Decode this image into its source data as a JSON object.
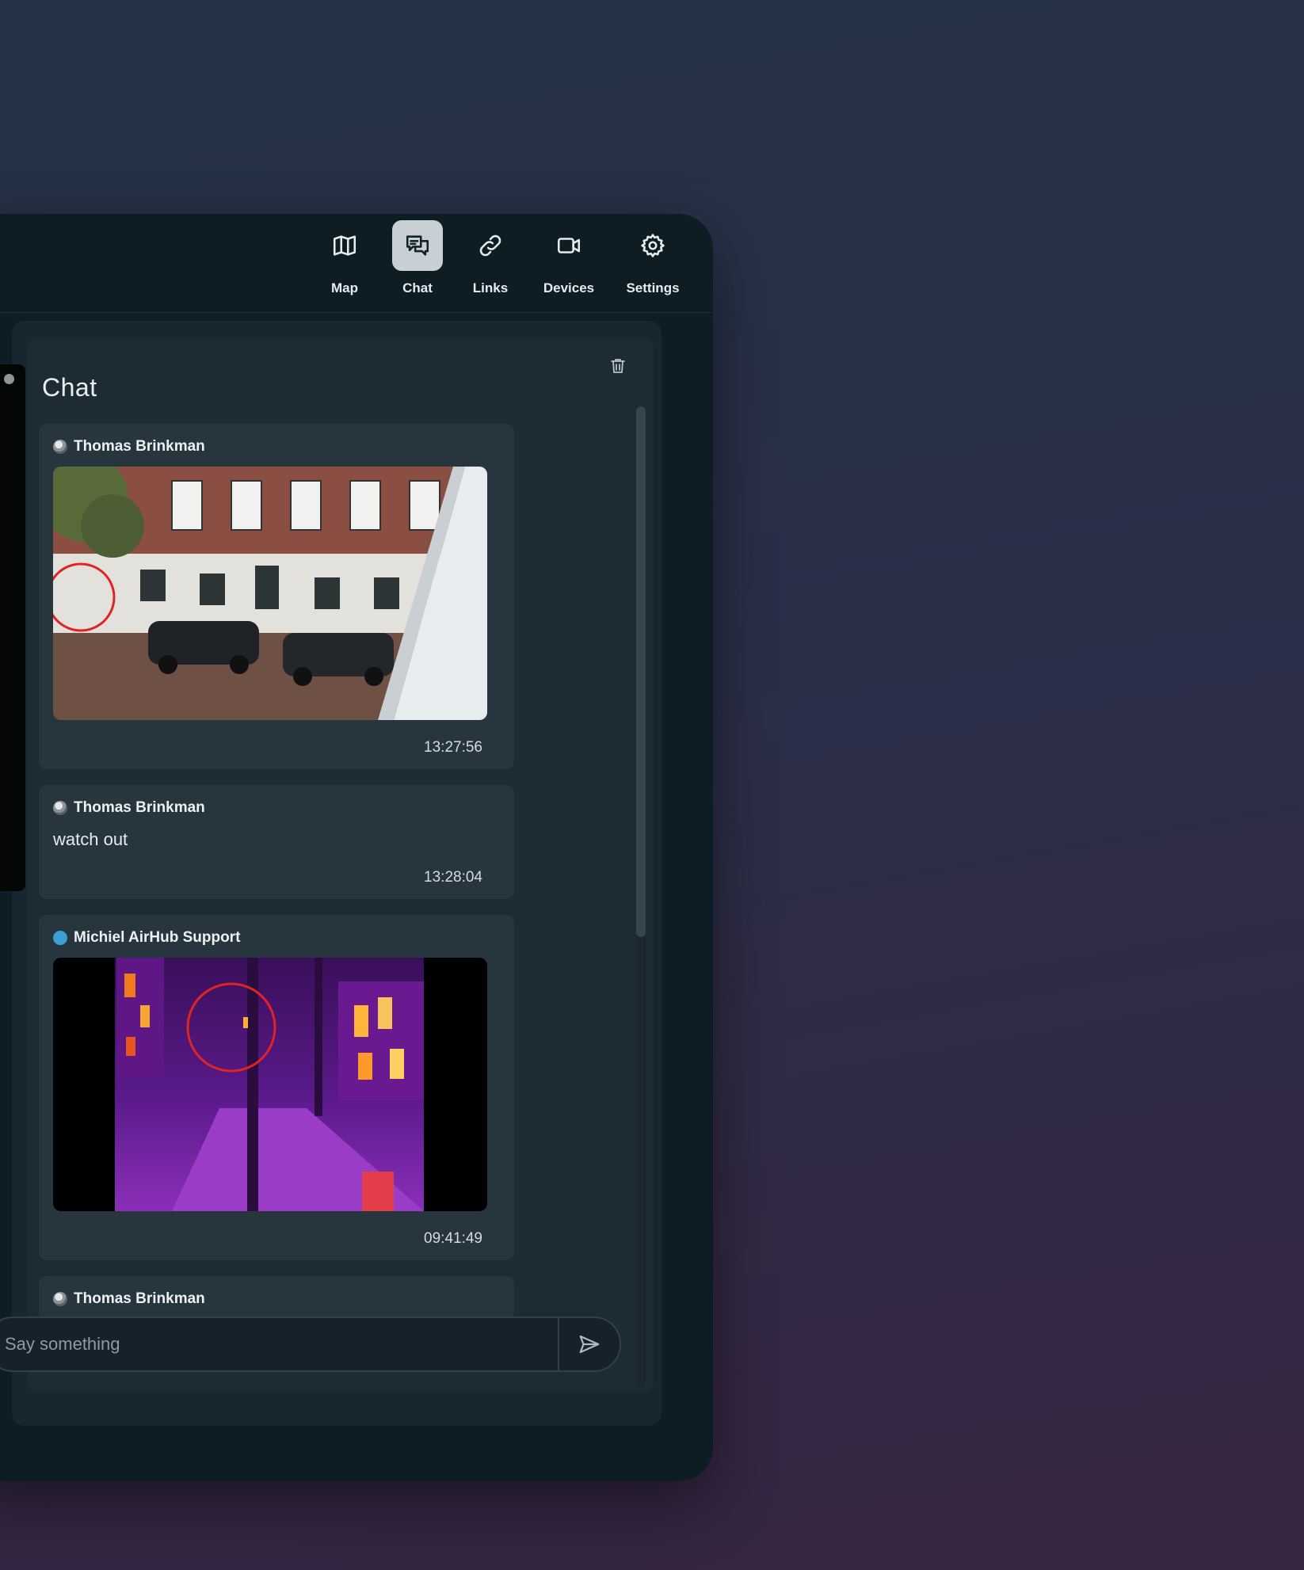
{
  "nav": {
    "items": [
      {
        "label": "Map",
        "icon": "map-icon",
        "active": false
      },
      {
        "label": "Chat",
        "icon": "chat-icon",
        "active": true
      },
      {
        "label": "Links",
        "icon": "link-icon",
        "active": false
      },
      {
        "label": "Devices",
        "icon": "video-camera-icon",
        "active": false
      },
      {
        "label": "Settings",
        "icon": "gear-icon",
        "active": false
      }
    ]
  },
  "chat": {
    "title": "Chat",
    "clear_icon": "trash-icon",
    "input_placeholder": "Say something",
    "send_icon": "send-icon",
    "messages": [
      {
        "author": "Thomas Brinkman",
        "avatar": "photo",
        "type": "image",
        "image": "street-photo",
        "time": "13:27:56"
      },
      {
        "author": "Thomas Brinkman",
        "avatar": "photo",
        "type": "text",
        "text": "watch out",
        "time": "13:28:04"
      },
      {
        "author": "Michiel AirHub Support",
        "avatar": "blue",
        "type": "image",
        "image": "thermal-image",
        "time": "09:41:49"
      },
      {
        "author": "Thomas Brinkman",
        "avatar": "photo",
        "type": "partial"
      }
    ]
  },
  "colors": {
    "panel": "#0e1c24",
    "message_bg": "#27353e",
    "active_nav": "#c9d0d5",
    "support_avatar": "#3aa2cf",
    "annotation_circle": "#e02424"
  }
}
